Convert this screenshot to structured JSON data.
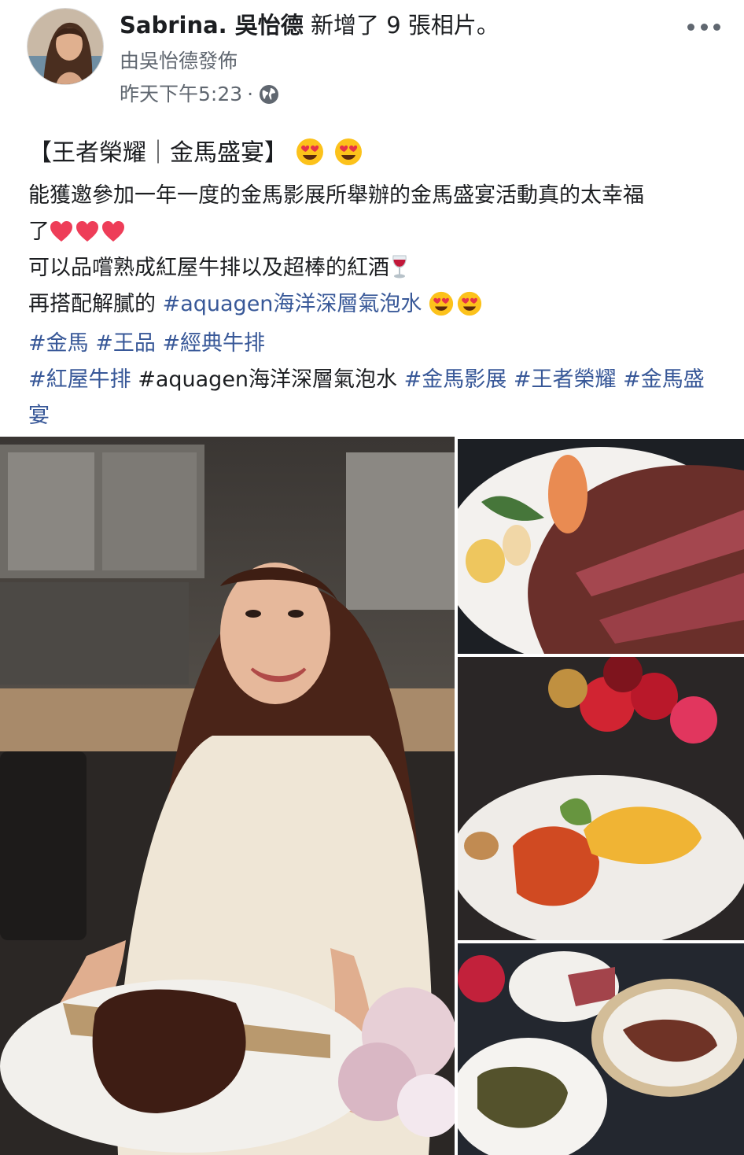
{
  "post": {
    "author": "Sabrina. 吳怡德",
    "action": "新增了 9 張相片。",
    "posted_by": "由吳怡德發佈",
    "timestamp": "昨天下午5:23",
    "separator": "·",
    "privacy_icon": "globe-icon",
    "more_icon": "more-options-icon"
  },
  "body": {
    "title": "【王者榮耀｜金馬盛宴】",
    "line1": "能獲邀參加一年一度的金馬影展所舉辦的金馬盛宴活動真的太幸福",
    "line2": "了",
    "line3": "可以品嚐熟成紅屋牛排以及超棒的紅酒",
    "line4_prefix": "再搭配解膩的 ",
    "line4_tag": "#aquagen海洋深層氣泡水",
    "tags_row1": [
      "#金馬",
      "#王品",
      "#經典牛排"
    ],
    "tags_row2_a": "#紅屋牛排",
    "tags_row2_plain": "#aquagen海洋深層氣泡水",
    "tags_row2_b": "#金馬影展",
    "tags_row2_c": "#王者榮耀",
    "tags_row2_d": "#金馬盛",
    "tags_row3": "宴",
    "emoji": {
      "face": "heart-eyes-emoji",
      "heart": "red-heart-emoji",
      "wine": "wine-glass-emoji"
    }
  },
  "photos": [
    "woman-with-steak",
    "steak-and-shrimp-plate",
    "lobster-and-flowers",
    "table-of-dishes"
  ],
  "colors": {
    "link": "#385898",
    "meta": "#606770",
    "text": "#1c1e21"
  }
}
